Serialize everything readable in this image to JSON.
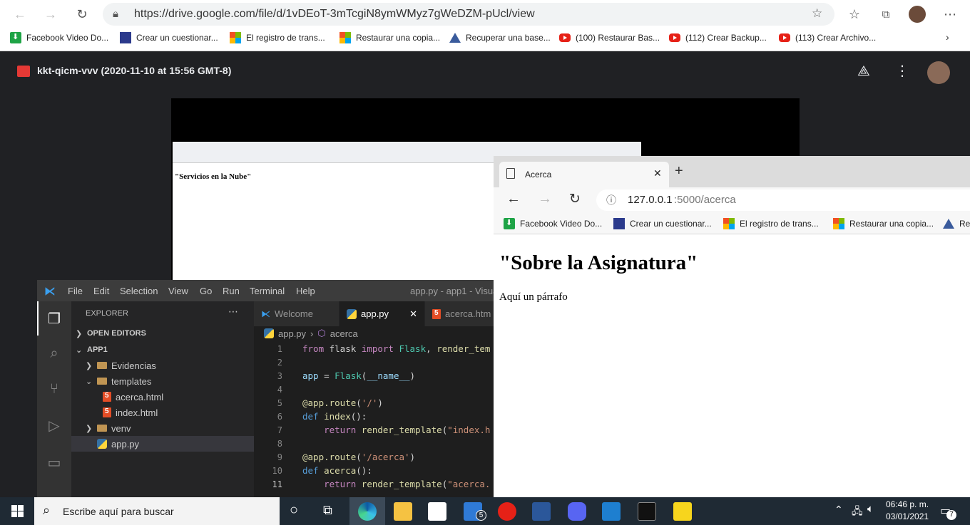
{
  "browser": {
    "url": "https://drive.google.com/file/d/1vDEoT-3mTcgiN8ymWMyz7gWeDZM-pUcl/view",
    "bookmarks": [
      {
        "label": "Facebook Video Do...",
        "icon": "green-download-icon"
      },
      {
        "label": "Crear un cuestionar...",
        "icon": "forms-icon"
      },
      {
        "label": "El registro de trans...",
        "icon": "microsoft-icon"
      },
      {
        "label": "Restaurar una copia...",
        "icon": "microsoft-icon"
      },
      {
        "label": "Recuperar una base...",
        "icon": "sql-icon"
      },
      {
        "label": "(100) Restaurar Bas...",
        "icon": "youtube-icon"
      },
      {
        "label": "(112) Crear Backup...",
        "icon": "youtube-icon"
      },
      {
        "label": "(113) Crear Archivo...",
        "icon": "youtube-icon"
      }
    ]
  },
  "drive": {
    "file_title": "kkt-qicm-vvv (2020-11-10 at 15:56 GMT-8)"
  },
  "video_inner": {
    "heading": "\"Servicios en la Nube\""
  },
  "vscode": {
    "menu": [
      "File",
      "Edit",
      "Selection",
      "View",
      "Go",
      "Run",
      "Terminal",
      "Help"
    ],
    "window_title": "app.py - app1 - Visual",
    "explorer_title": "EXPLORER",
    "open_editors": "OPEN EDITORS",
    "project": "APP1",
    "tree": [
      "Evidencias",
      "templates",
      "acerca.html",
      "index.html",
      "venv",
      "app.py"
    ],
    "tabs": [
      "Welcome",
      "app.py",
      "acerca.htm"
    ],
    "breadcrumb": [
      "app.py",
      "acerca"
    ],
    "line_numbers": [
      "1",
      "2",
      "3",
      "4",
      "5",
      "6",
      "7",
      "8",
      "9",
      "10",
      "11"
    ]
  },
  "edge": {
    "tab_title": "Acerca",
    "url_host": "127.0.0.1",
    "url_path": ":5000/acerca",
    "bookmarks": [
      "Facebook Video Do...",
      "Crear un cuestionar...",
      "El registro de trans...",
      "Restaurar una copia...",
      "Re"
    ],
    "page_heading": "\"Sobre la Asignatura\"",
    "page_paragraph": "Aquí un párrafo"
  },
  "taskbar": {
    "search_placeholder": "Escribe aquí para buscar",
    "mail_badge": "5",
    "time": "06:46 p. m.",
    "date": "03/01/2021",
    "notification_count": "7"
  }
}
